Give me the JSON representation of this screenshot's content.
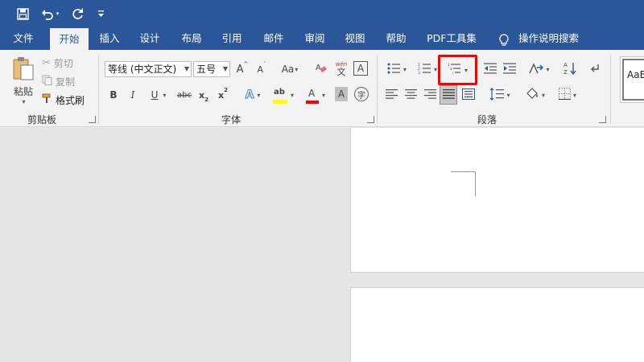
{
  "quick_access": {
    "save_icon": "save-icon",
    "undo_icon": "undo-icon",
    "redo_icon": "redo-icon",
    "customize_icon": "customize-qat-icon"
  },
  "tabs": [
    "文件",
    "开始",
    "插入",
    "设计",
    "布局",
    "引用",
    "邮件",
    "审阅",
    "视图",
    "帮助",
    "PDF工具集",
    "操作说明搜索"
  ],
  "clipboard": {
    "paste": "粘贴",
    "cut": "剪切",
    "copy": "复制",
    "format_painter": "格式刷",
    "label": "剪贴板"
  },
  "font": {
    "name": "等线 (中文正文)",
    "size": "五号",
    "label": "字体",
    "case_btn": "Aa",
    "bold": "B",
    "italic": "I",
    "underline": "U",
    "strike": "abc",
    "subscript": "x",
    "superscript": "x",
    "phonetic_top": "wén",
    "phonetic_bottom": "文",
    "border_char": "A",
    "enclosed_char": "字",
    "grow": "A",
    "shrink": "A",
    "text_effect": "A",
    "highlight": "ab",
    "font_color": "A",
    "char_shade": "A"
  },
  "paragraph": {
    "label": "段落"
  },
  "styles": {
    "preview": "AaB"
  },
  "colors": {
    "accent": "#2b579a",
    "highlight_box": "#ff0000",
    "font_color_bar": "#ff0000",
    "highlight_bar": "#ffff00"
  }
}
